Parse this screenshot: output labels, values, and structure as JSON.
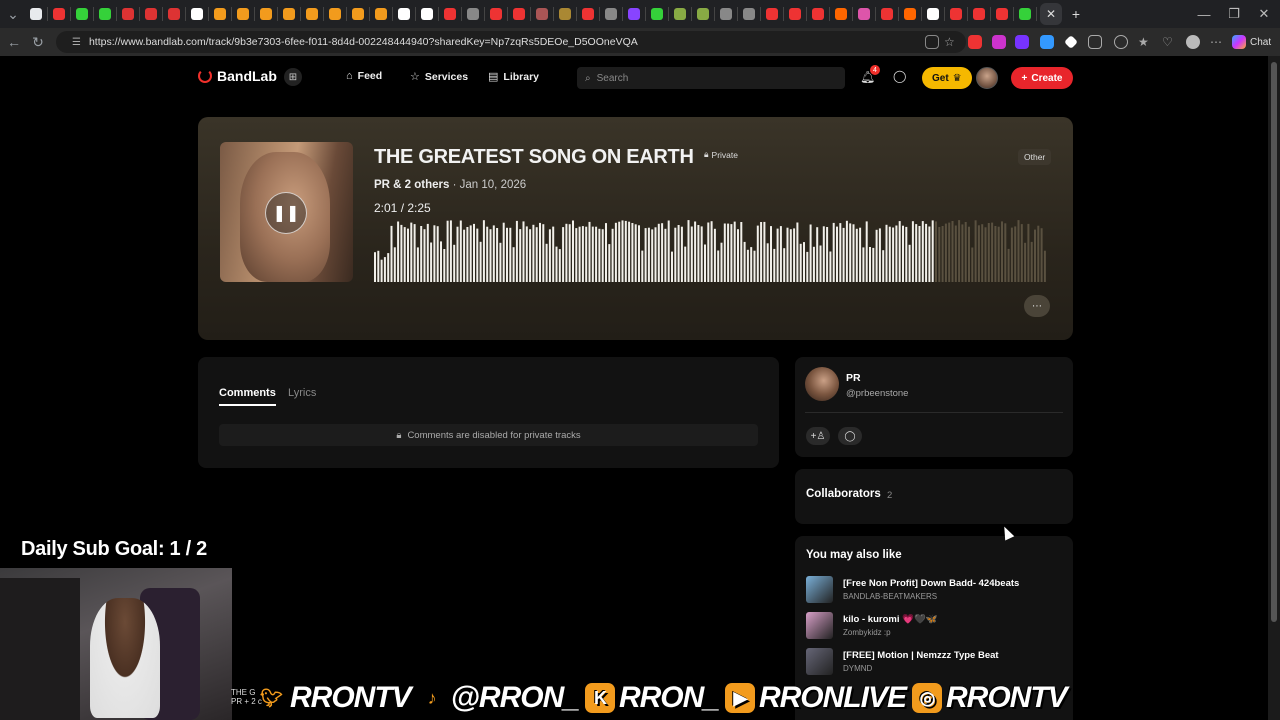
{
  "browser": {
    "url": "https://www.bandlab.com/track/9b3e7303-6fee-f011-8d4d-002248444940?sharedKey=Np7zqRs5DEOe_D5OOneVQA",
    "chat_label": "Chat",
    "tab_colors": [
      "#e8eaed",
      "#e33",
      "#35d13a",
      "#35d13a",
      "#d33",
      "#d33",
      "#d33",
      "#fff",
      "#f29b1d",
      "#f29b1d",
      "#f29b1d",
      "#f29b1d",
      "#f29b1d",
      "#f29b1d",
      "#f29b1d",
      "#f29b1d",
      "#fff",
      "#fff",
      "#e33",
      "#888",
      "#e33",
      "#e33",
      "#a55",
      "#a83",
      "#e33",
      "#888",
      "#84f",
      "#35d13a",
      "#8a4",
      "#8a4",
      "#888",
      "#888",
      "#e33",
      "#e33",
      "#e33",
      "#f60",
      "#d5a",
      "#e33",
      "#f60",
      "#fff",
      "#e33",
      "#e33",
      "#e33",
      "#35d13a"
    ]
  },
  "nav": {
    "logo": "BandLab",
    "feed": "Feed",
    "services": "Services",
    "library": "Library",
    "search_placeholder": "Search",
    "notification_count": "4",
    "get_label": "Get",
    "create_label": "Create"
  },
  "track": {
    "title": "THE GREATEST SONG ON EARTH",
    "privacy": "Private",
    "genre": "Other",
    "artists": "PR & 2 others",
    "date": "· Jan 10, 2026",
    "time": "2:01 /  2:25",
    "progress": 0.834
  },
  "comments": {
    "tab_comments": "Comments",
    "tab_lyrics": "Lyrics",
    "disabled_text": "Comments are disabled for private tracks"
  },
  "artist": {
    "name": "PR",
    "handle": "@prbeenstone"
  },
  "collaborators": {
    "title": "Collaborators",
    "count": "2"
  },
  "also_like": {
    "title": "You may also like",
    "items": [
      {
        "name": "[Free Non Profit] Down Badd- 424beats",
        "user": "BANDLAB-BEATMAKERS",
        "color": "#7ab0d8"
      },
      {
        "name": "kilo - kuromi 💗🖤🦋",
        "user": "Zombykidz :p",
        "color": "#d8a0c8"
      },
      {
        "name": "[FREE] Motion | Nemzzz Type Beat",
        "user": "DYMND",
        "color": "#667"
      }
    ]
  },
  "overlay": {
    "goal": "Daily Sub Goal:  1 / 2",
    "banner_small_1": "THE G",
    "banner_small_2": "PR + 2 c",
    "twitter": "RRONTV",
    "tiktok": "@RRON_",
    "kick": "RRON_",
    "youtube": "RRONLIVE",
    "instagram": "RRONTV"
  }
}
